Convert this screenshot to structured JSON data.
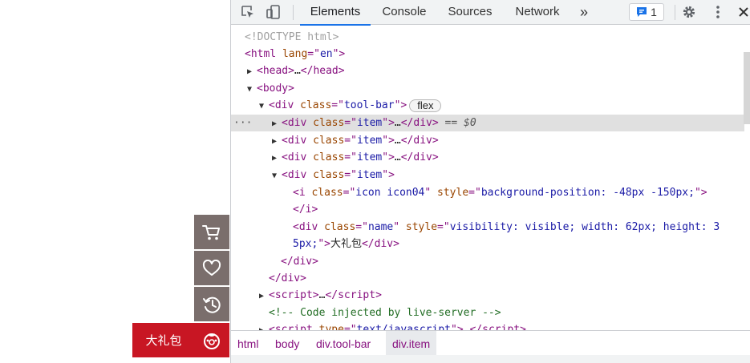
{
  "page": {
    "tool_bar": {
      "gift_label": "大礼包",
      "buttons": [
        {
          "icon": "cart-icon"
        },
        {
          "icon": "heart-icon"
        },
        {
          "icon": "history-icon"
        },
        {
          "icon": "gift-icon"
        }
      ]
    }
  },
  "devtools": {
    "tabs": [
      "Elements",
      "Console",
      "Sources",
      "Network"
    ],
    "active_tab": "Elements",
    "more_tabs": "»",
    "issues_count": "1",
    "breadcrumbs": [
      "html",
      "body",
      "div.tool-bar",
      "div.item"
    ],
    "tree": {
      "doctype": "<!DOCTYPE html>",
      "html_open_tag": "html",
      "html_lang_attr": "lang",
      "html_lang_val": "en",
      "head_collapsed": "head",
      "head_ellipsis": "…",
      "body_tag": "body",
      "div_tag": "div",
      "class_attr": "class",
      "toolbar_class": "tool-bar",
      "flex_badge": "flex",
      "item_class": "item",
      "ellipsis": "…",
      "selected_marker": "== $0",
      "i_tag": "i",
      "icon_class": "icon icon04",
      "style_attr": "style",
      "icon_style": "background-position: -48px -150px;",
      "name_class": "name",
      "name_style_part1": "visibility: visible; width: 62px; height: 3",
      "name_style_part2": "5px;",
      "name_text": "大礼包",
      "script_tag": "script",
      "comment": "<!-- Code injected by live-server -->",
      "script_type_attr": "type",
      "script_type_val": "text/javascript"
    }
  }
}
